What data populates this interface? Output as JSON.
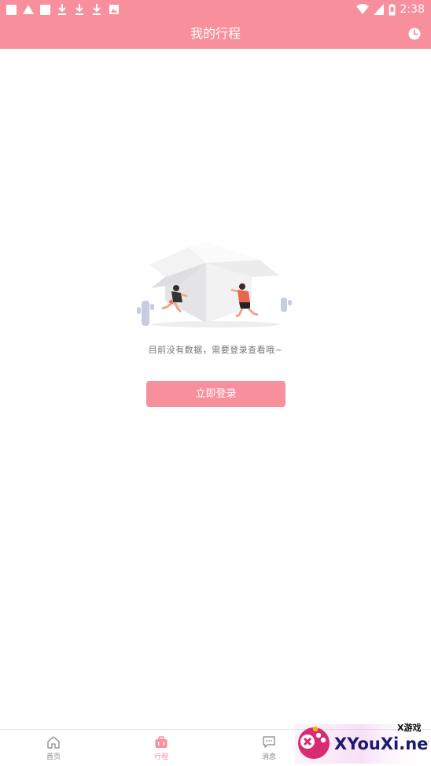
{
  "status_bar": {
    "time": "2:38"
  },
  "header": {
    "title": "我的行程"
  },
  "empty_state": {
    "message": "目前没有数据，需要登录查看哦~"
  },
  "login_button": {
    "label": "立即登录"
  },
  "tabs": [
    {
      "label": "首页",
      "icon": "home-icon",
      "active": false
    },
    {
      "label": "行程",
      "icon": "suitcase-icon",
      "active": true
    },
    {
      "label": "消息",
      "icon": "chat-icon",
      "active": false
    }
  ],
  "watermark": {
    "top_text": "X游戏",
    "brand": "XYouXi.net"
  },
  "colors": {
    "accent": "#f78f9c",
    "text_muted": "#777777",
    "tab_inactive": "#888888"
  }
}
